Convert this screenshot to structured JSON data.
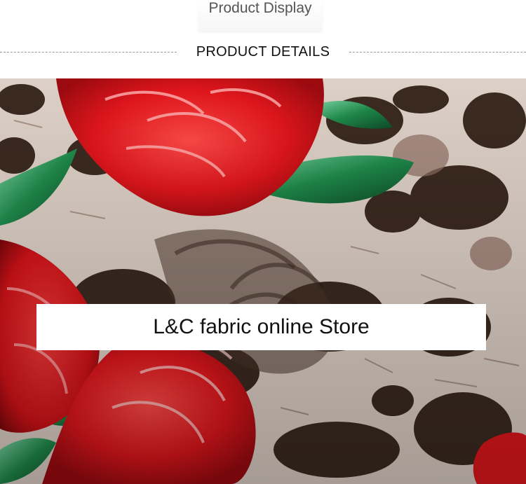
{
  "header": {
    "tab_label": "Product Display",
    "section_title": "PRODUCT DETAILS"
  },
  "photo": {
    "subject": "rose and leopard print fabric",
    "banner_text": "L&C fabric online Store"
  },
  "colors": {
    "rose_red": "#e0161c",
    "leaf_green": "#1f8a4a",
    "spot_brown": "#3b2a20",
    "fabric_cream": "#efe7e2"
  }
}
